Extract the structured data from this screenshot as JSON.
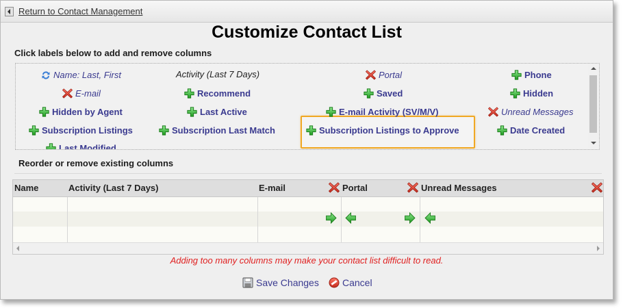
{
  "nav": {
    "back_label": "Return to Contact Management"
  },
  "page": {
    "title": "Customize Contact List",
    "add_section_label": "Click labels below to add and remove columns",
    "reorder_section_label": "Reorder or remove existing columns",
    "warning": "Adding too many columns may make your contact list difficult to read."
  },
  "available_columns": [
    {
      "label": "Name: Last, First",
      "state": "sort"
    },
    {
      "label": "Activity (Last 7 Days)",
      "state": "fixed"
    },
    {
      "label": "Portal",
      "state": "remove"
    },
    {
      "label": "Phone",
      "state": "add"
    },
    {
      "label": "E-mail",
      "state": "remove"
    },
    {
      "label": "Recommend",
      "state": "add"
    },
    {
      "label": "Saved",
      "state": "add"
    },
    {
      "label": "Hidden",
      "state": "add"
    },
    {
      "label": "Hidden by Agent",
      "state": "add"
    },
    {
      "label": "Last Active",
      "state": "add"
    },
    {
      "label": "E-mail Activity (SV/M/V)",
      "state": "add"
    },
    {
      "label": "Unread Messages",
      "state": "remove"
    },
    {
      "label": "Subscription Listings",
      "state": "add"
    },
    {
      "label": "Subscription Last Match",
      "state": "add"
    },
    {
      "label": "Subscription Listings to Approve",
      "state": "add",
      "highlighted": true
    },
    {
      "label": "Date Created",
      "state": "add"
    },
    {
      "label": "Last Modified",
      "state": "add"
    }
  ],
  "current_columns": [
    {
      "label": "Name"
    },
    {
      "label": "Activity (Last 7 Days)"
    },
    {
      "label": "E-mail"
    },
    {
      "label": "Portal",
      "removable": true
    },
    {
      "label": "Unread Messages",
      "removable": true
    }
  ],
  "actions": {
    "save": "Save Changes",
    "cancel": "Cancel"
  },
  "colors": {
    "highlight": "#f0a824",
    "link": "#3a3a8f",
    "warning": "#e02020",
    "add_icon": "#2fb52f",
    "remove_icon": "#d93a2a"
  }
}
